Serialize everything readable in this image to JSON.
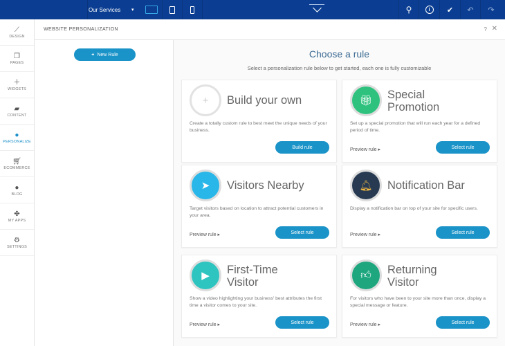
{
  "topbar": {
    "page_select": "Our Services",
    "icons": [
      "desktop-icon",
      "tablet-icon",
      "mobile-icon",
      "collapse-chevron-icon",
      "search-icon",
      "info-icon",
      "check-icon",
      "undo-icon",
      "redo-icon"
    ]
  },
  "sidebar": {
    "items": [
      {
        "label": "DESIGN",
        "icon": "brush-icon"
      },
      {
        "label": "PAGES",
        "icon": "pages-icon"
      },
      {
        "label": "WIDGETS",
        "icon": "plus-icon"
      },
      {
        "label": "CONTENT",
        "icon": "folder-icon"
      },
      {
        "label": "PERSONALIZE",
        "icon": "person-icon",
        "active": true
      },
      {
        "label": "ECOMMERCE",
        "icon": "cart-icon"
      },
      {
        "label": "BLOG",
        "icon": "chat-bubble-icon"
      },
      {
        "label": "MY APPS",
        "icon": "puzzle-icon"
      },
      {
        "label": "SETTINGS",
        "icon": "gear-icon"
      }
    ]
  },
  "header": {
    "title": "WEBSITE PERSONALIZATION",
    "help": "?",
    "close": "✕"
  },
  "left": {
    "new_rule": "New Rule"
  },
  "main": {
    "title": "Choose a rule",
    "subtitle": "Select a personalization rule below to get started, each one is fully customizable",
    "cards": [
      {
        "title": "Build your own",
        "desc": "Create a totally custom rule to best meet the unique needs of your business.",
        "button": "Build rule",
        "color": "#ffffff",
        "icon": "plus-icon"
      },
      {
        "title": "Special Promotion",
        "desc": "Set up a special promotion that will run each year for a defined period of time.",
        "preview": "Preview rule ▸",
        "button": "Select rule",
        "color": "#2ec27e",
        "icon": "gift-icon"
      },
      {
        "title": "Visitors Nearby",
        "desc": "Target visitors based on location to attract potential customers in your area.",
        "preview": "Preview rule ▸",
        "button": "Select rule",
        "color": "#29b6e8",
        "icon": "paper-plane-icon"
      },
      {
        "title": "Notification Bar",
        "desc": "Display a notification bar on top of your site for specific users.",
        "preview": "Preview rule ▸",
        "button": "Select rule",
        "color": "#273a52",
        "icon": "bell-icon"
      },
      {
        "title": "First-Time Visitor",
        "desc": "Show a video highlighting your business' best attributes the first time a visitor comes to your site.",
        "preview": "Preview rule ▸",
        "button": "Select rule",
        "color": "#2ec4c0",
        "icon": "video-person-icon"
      },
      {
        "title": "Returning Visitor",
        "desc": "For visitors who have been to your site more than once, display a special message or feature.",
        "preview": "Preview rule ▸",
        "button": "Select rule",
        "color": "#1ea67f",
        "icon": "thumbs-up-icon"
      }
    ]
  }
}
